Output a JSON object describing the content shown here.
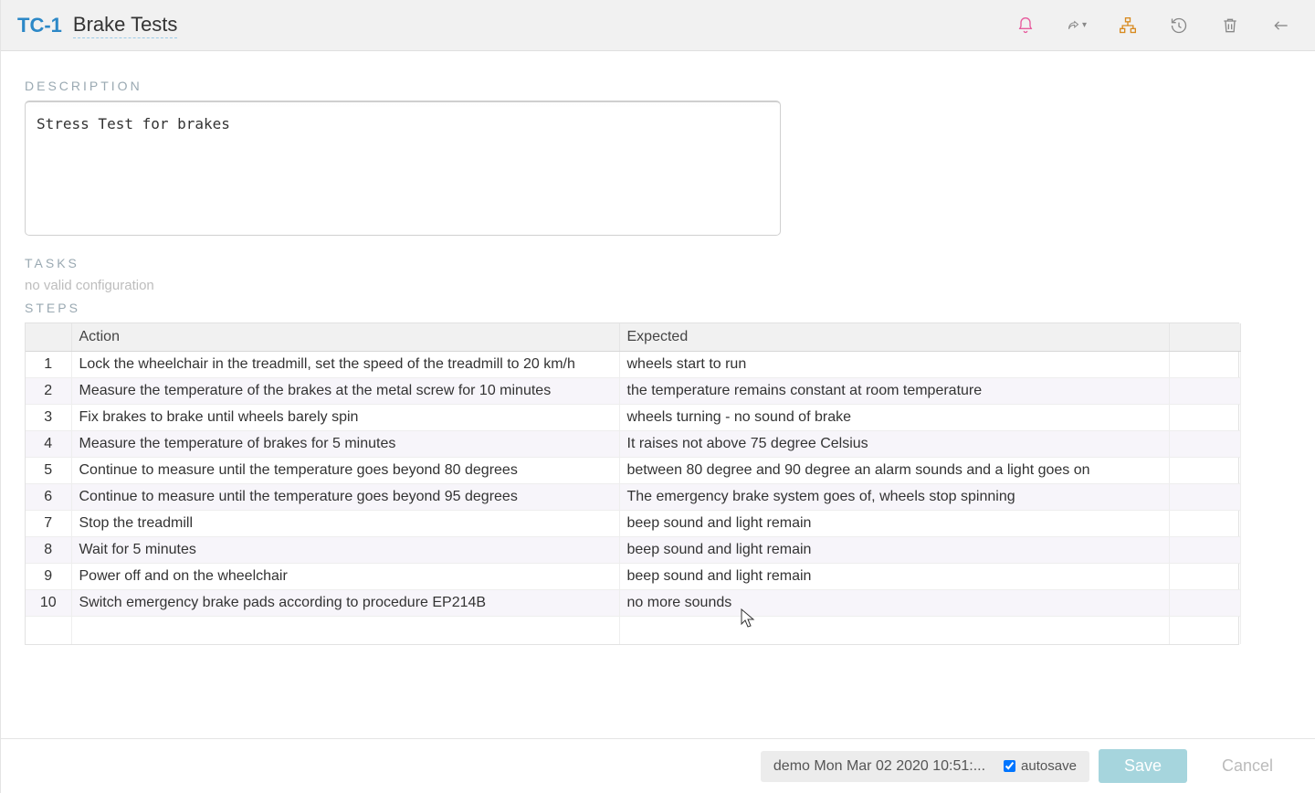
{
  "header": {
    "id": "TC-1",
    "title": "Brake Tests"
  },
  "sections": {
    "description_label": "DESCRIPTION",
    "tasks_label": "TASKS",
    "tasks_message": "no valid configuration",
    "steps_label": "STEPS"
  },
  "description": "Stress Test for brakes",
  "steps": {
    "columns": {
      "action": "Action",
      "expected": "Expected"
    },
    "rows": [
      {
        "n": "1",
        "action": "Lock the wheelchair in the treadmill, set the speed of the treadmill to 20 km/h",
        "expected": "wheels start to run"
      },
      {
        "n": "2",
        "action": "Measure the temperature of the brakes at the metal screw for 10 minutes",
        "expected": "the temperature remains constant at room temperature"
      },
      {
        "n": "3",
        "action": "Fix brakes to brake until wheels barely spin",
        "expected": "wheels turning - no sound of brake"
      },
      {
        "n": "4",
        "action": "Measure the temperature of brakes for 5 minutes",
        "expected": "It raises not above 75 degree Celsius"
      },
      {
        "n": "5",
        "action": "Continue to measure until the temperature goes beyond 80 degrees",
        "expected": "between 80 degree and 90 degree an alarm sounds and a light goes on"
      },
      {
        "n": "6",
        "action": "Continue to measure until the temperature goes beyond 95 degrees",
        "expected": "The emergency brake system goes of, wheels stop spinning"
      },
      {
        "n": "7",
        "action": "Stop the treadmill",
        "expected": "beep sound and light remain"
      },
      {
        "n": "8",
        "action": "Wait for 5 minutes",
        "expected": "beep sound and light remain"
      },
      {
        "n": "9",
        "action": "Power off and on the wheelchair",
        "expected": "beep sound and light remain"
      },
      {
        "n": "10",
        "action": "Switch emergency brake pads according to procedure EP214B",
        "expected": "no more sounds"
      }
    ]
  },
  "footer": {
    "status": "demo Mon Mar 02 2020 10:51:...",
    "autosave_label": "autosave",
    "autosave_checked": true,
    "save_label": "Save",
    "cancel_label": "Cancel"
  },
  "colors": {
    "accent": "#2c88c7",
    "bell": "#e75b9d",
    "hierarchy": "#d88a1f"
  }
}
